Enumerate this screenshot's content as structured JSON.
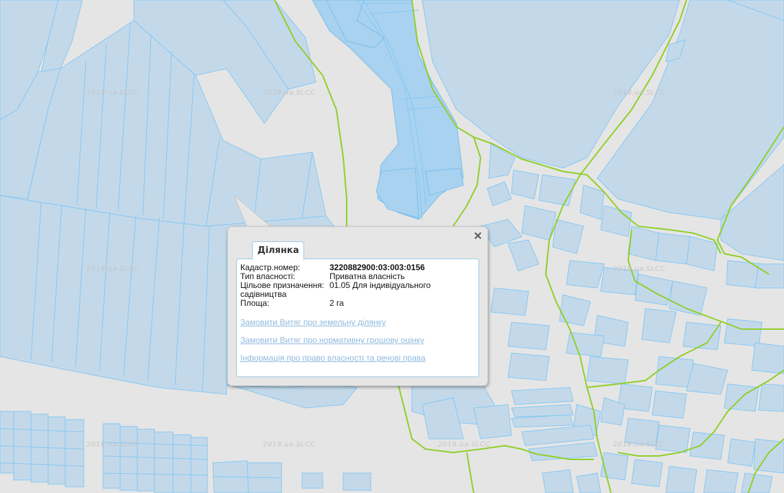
{
  "map": {
    "watermark": "2018.ua.SLCC",
    "colors": {
      "background": "#e5e5e5",
      "parcel_fill": "#c3d9ea",
      "parcel_border": "#86c7f2",
      "parcel_selected_fill": "#a8d2f0",
      "boundary_line": "#8fcf2a"
    }
  },
  "popup": {
    "tab_label": "Ділянка",
    "close_icon": "close-icon",
    "fields": [
      {
        "label": "Кадастр.номер:",
        "value": "3220882900:03:003:0156"
      },
      {
        "label": "Тип власності:",
        "value": "Приватна власність"
      },
      {
        "label": "Цільове призначення:",
        "value": "01.05 Для індивідуального"
      },
      {
        "label": "садівництва",
        "value": ""
      },
      {
        "label": "Площа:",
        "value": "2 га"
      }
    ],
    "links": [
      "Замовити Витяг про земельну ділянку",
      "Замовити Витяг про нормативну грошову оцінку",
      "Інформація про право власності та речові права"
    ]
  }
}
